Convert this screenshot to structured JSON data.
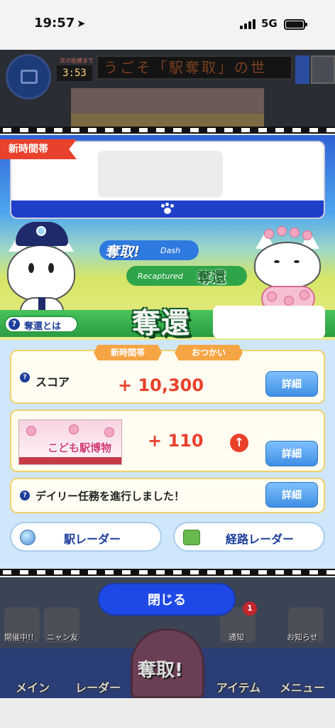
{
  "status_bar": {
    "time": "19:57",
    "network": "5G"
  },
  "header": {
    "timer_label": "次の振替まで",
    "timer": "3:53",
    "ticker": "うごそ「駅奪取」の世"
  },
  "scene": {
    "new_time_tag": "新時間帯",
    "dash_title": "奪取!",
    "dash_sub": "Dash",
    "recap_sub": "Recaptured",
    "recap_title": "奪還",
    "help_label": "奪還とは",
    "big_title": "奪還"
  },
  "rewards": {
    "tags": [
      "新時間帯",
      "おつかい"
    ],
    "score_label": "スコア",
    "score_value": "+ 10,300",
    "event_value": "+ 110",
    "event_banner": "こども駅博物館",
    "daily_label": "デイリー任務を進行しました！",
    "detail_label": "詳細"
  },
  "radar": {
    "station": "駅レーダー",
    "route": "経路レーダー"
  },
  "footer": {
    "close_label": "閉じる",
    "mini": [
      "開催中!!",
      "ニャン友",
      "通知",
      "お知らせ"
    ],
    "notify_count": "1",
    "nav": [
      "メイン",
      "レーダー",
      "奪取!",
      "アイテム",
      "メニュー"
    ]
  },
  "colors": {
    "accent_blue": "#1f49e6",
    "score_red": "#e9412b",
    "tag_orange": "#f5a544",
    "recap_green": "#2fa54a"
  }
}
